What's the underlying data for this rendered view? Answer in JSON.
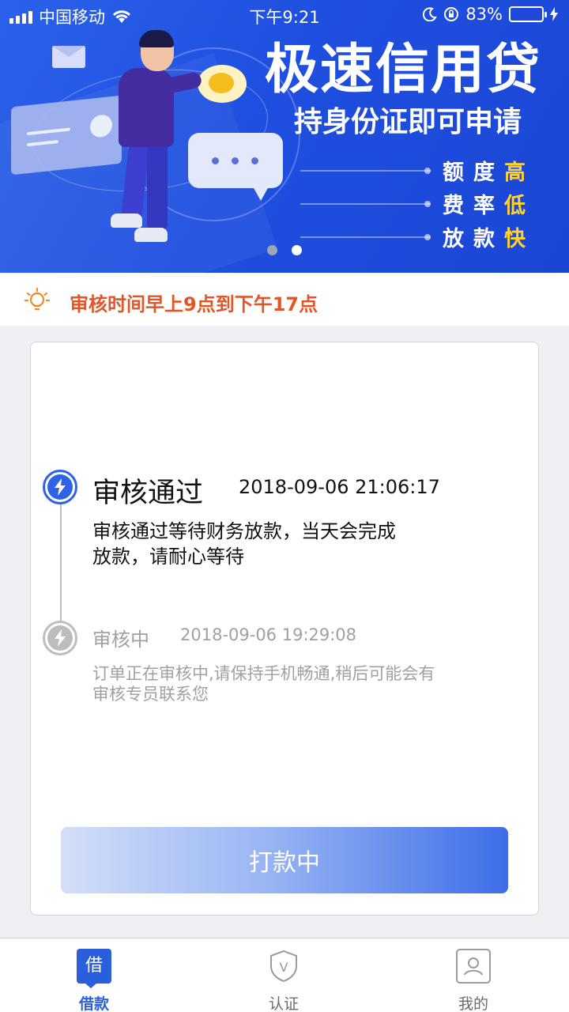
{
  "status_bar": {
    "carrier": "中国移动",
    "time": "下午9:21",
    "battery": "83%",
    "battery_level": 0.83
  },
  "banner": {
    "title": "极速信用贷",
    "subtitle": "持身份证即可申请",
    "features": [
      {
        "label": "额度",
        "value": "高"
      },
      {
        "label": "费率",
        "value": "低"
      },
      {
        "label": "放款",
        "value": "快"
      }
    ],
    "page_count": 2,
    "active_page": 2,
    "highlight_color": "#ffd333"
  },
  "notice": {
    "text": "审核时间早上9点到下午17点",
    "color": "#e0562a"
  },
  "timeline": {
    "steps": [
      {
        "title": "审核通过",
        "time": "2018-09-06 21:06:17",
        "desc_line1": "审核通过等待财务放款，当天会完成",
        "desc_line2": "放款，请耐心等待",
        "state": "active"
      },
      {
        "title": "审核中",
        "time": "2018-09-06 19:29:08",
        "desc_line1": "订单正在审核中,请保持手机畅通,稍后可能会有",
        "desc_line2": "审核专员联系您",
        "state": "done"
      }
    ]
  },
  "action_button": "打款中",
  "tabbar": {
    "items": [
      {
        "label": "借款",
        "icon_glyph": "借",
        "active": true
      },
      {
        "label": "认证",
        "icon_glyph": "V",
        "active": false
      },
      {
        "label": "我的",
        "icon_glyph": "",
        "active": false
      }
    ]
  },
  "colors": {
    "primary": "#2a5fdb",
    "active_node": "#2f63e6",
    "inactive": "#bdbdbd"
  }
}
